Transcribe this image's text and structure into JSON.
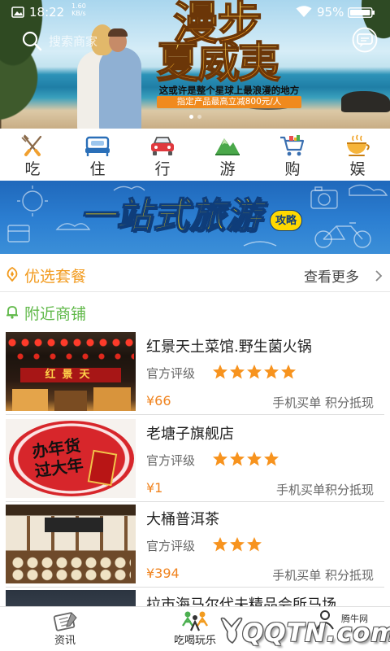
{
  "status_bar": {
    "time": "18:22",
    "net_speed": "1.60",
    "net_unit": "KB/s",
    "battery": "95%"
  },
  "search": {
    "placeholder": "搜索商家"
  },
  "hero": {
    "title_line1": "漫步",
    "title_line2": "夏威夷",
    "subtitle": "这或许是整个星球上最浪漫的地方",
    "promo": "指定产品最高立减800元/人",
    "slide_count": 2,
    "active_slide": 0
  },
  "categories": [
    {
      "label": "吃",
      "icon": "fork-knife-icon"
    },
    {
      "label": "住",
      "icon": "bed-icon"
    },
    {
      "label": "行",
      "icon": "car-icon"
    },
    {
      "label": "游",
      "icon": "mountain-icon"
    },
    {
      "label": "购",
      "icon": "cart-icon"
    },
    {
      "label": "娱",
      "icon": "teacup-icon"
    }
  ],
  "guide_banner": {
    "title": "一站式旅游",
    "badge": "攻略"
  },
  "featured": {
    "title": "优选套餐",
    "more_label": "查看更多",
    "icon": "pin-icon"
  },
  "nearby": {
    "title": "附近商铺",
    "icon": "bell-icon"
  },
  "shops": [
    {
      "name": "红景天土菜馆.野生菌火锅",
      "rating_label": "官方评级",
      "stars": 5,
      "price": "¥66",
      "tags": "手机买单 积分抵现",
      "image_text": "红景天"
    },
    {
      "name": "老塘子旗舰店",
      "rating_label": "官方评级",
      "stars": 4,
      "price": "¥1",
      "tags": "手机买单积分抵现",
      "image_text_1": "办年货",
      "image_text_2": "过大年"
    },
    {
      "name": "大桶普洱茶",
      "rating_label": "官方评级",
      "stars": 3,
      "price": "¥394",
      "tags": "手机买单 积分抵现"
    },
    {
      "name": "拉市海马尔代夫精品会所马场"
    }
  ],
  "tabs": [
    {
      "label": "资讯",
      "icon": "news-icon"
    },
    {
      "label": "吃喝玩乐",
      "icon": "eat-play-icon",
      "active": true
    },
    {
      "icon": "user-icon"
    }
  ],
  "watermark": {
    "logo_text": "QQTN.com",
    "site_name": "腾牛网"
  },
  "theme": {
    "orange": "#f29b1f",
    "price": "#f0831e",
    "green": "#5fb848",
    "star": "#f7931e",
    "banner_blue": "#2a78cc"
  }
}
